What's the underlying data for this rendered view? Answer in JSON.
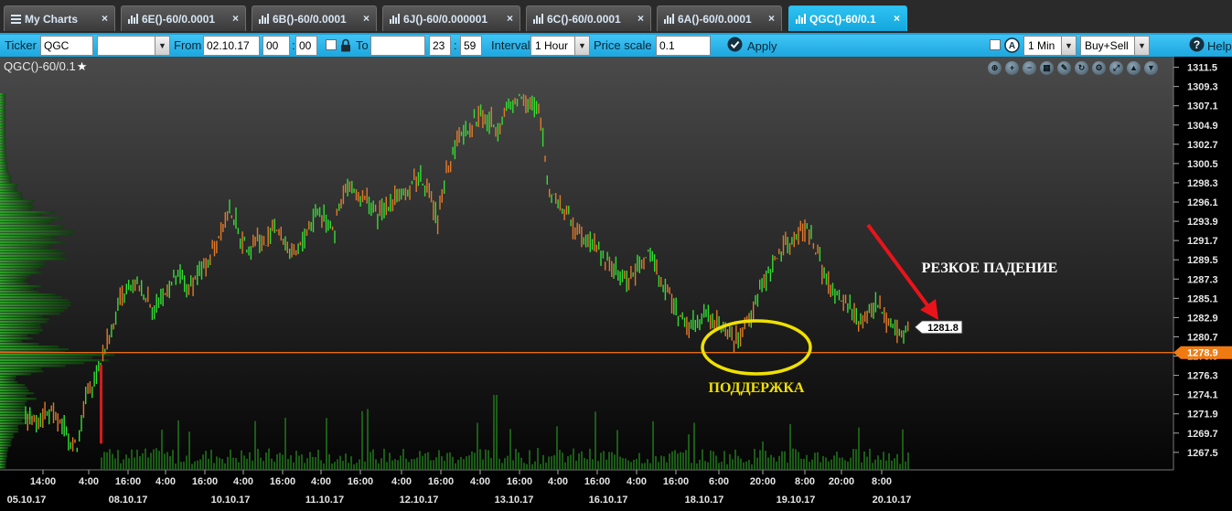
{
  "tabs": [
    {
      "label": "My Charts",
      "x": 4,
      "w": 122,
      "icon": "list-icon",
      "active": false
    },
    {
      "label": "6E()-60/0.0001",
      "x": 132,
      "w": 137,
      "icon": "bar-chart-icon",
      "active": false
    },
    {
      "label": "6B()-60/0.0001",
      "x": 275,
      "w": 137,
      "icon": "bar-chart-icon",
      "active": false
    },
    {
      "label": "6J()-60/0.000001",
      "x": 418,
      "w": 151,
      "icon": "bar-chart-icon",
      "active": false
    },
    {
      "label": "6C()-60/0.0001",
      "x": 575,
      "w": 137,
      "icon": "bar-chart-icon",
      "active": false
    },
    {
      "label": "6A()-60/0.0001",
      "x": 718,
      "w": 137,
      "icon": "bar-chart-icon",
      "active": false
    },
    {
      "label": "QGC()-60/0.1",
      "x": 862,
      "w": 130,
      "icon": "bar-chart-icon",
      "active": true
    }
  ],
  "toolbar": {
    "ticker_label": "Ticker",
    "ticker_value": "QGC",
    "ticker_select_value": "",
    "from_label": "From",
    "from_date": "02.10.17",
    "from_hour": "00",
    "from_min": "00",
    "to_label": "To",
    "to_date": "",
    "to_hour": "23",
    "to_min": "59",
    "interval_label": "Interval",
    "interval_value": "1 Hour",
    "price_scale_label": "Price scale",
    "price_scale_value": "0.1",
    "apply_label": "Apply",
    "timeframe_value": "1 Min",
    "side_value": "Buy+Sell",
    "help_label": "Help"
  },
  "chart": {
    "title": "QGC()-60/0.1",
    "current_price_label": "1281.8",
    "support_level_label": "1278.9",
    "annotation_support": "ПОДДЕРЖКА",
    "annotation_drop": "РЕЗКОЕ ПАДЕНИЕ",
    "colors": {
      "up_bar": "#33dd33",
      "down_bar": "#e07a2a",
      "support_line": "#e86a10",
      "circle": "#f0e000",
      "arrow": "#e8141a",
      "profile": "#2fae2a"
    }
  },
  "chart_data": {
    "type": "line",
    "title": "QGC()-60/0.1",
    "xlabel": "",
    "ylabel": "",
    "y_ticks": [
      "1311.5",
      "1309.3",
      "1307.1",
      "1304.9",
      "1302.7",
      "1300.5",
      "1298.3",
      "1296.1",
      "1293.9",
      "1291.7",
      "1289.5",
      "1287.3",
      "1285.1",
      "1282.9",
      "1280.7",
      "1278.5",
      "1276.3",
      "1274.1",
      "1271.9",
      "1269.7",
      "1267.5"
    ],
    "ylim": [
      1265.5,
      1312.5
    ],
    "x_time_labels": [
      "14:00",
      "4:00",
      "16:00",
      "4:00",
      "16:00",
      "4:00",
      "16:00",
      "4:00",
      "16:00",
      "4:00",
      "16:00",
      "4:00",
      "16:00",
      "4:00",
      "16:00",
      "4:00",
      "16:00",
      "6:00",
      "20:00",
      "8:00",
      "20:00",
      "8:00"
    ],
    "x_date_labels": [
      "05.10.17",
      "08.10.17",
      "10.10.17",
      "11.10.17",
      "12.10.17",
      "13.10.17",
      "16.10.17",
      "18.10.17",
      "19.10.17",
      "20.10.17"
    ],
    "series": [
      {
        "values": [
          1271.5,
          1271.0,
          1272.0,
          1271.8,
          1270.5,
          1269.6,
          1268.0,
          1273.5,
          1276.0,
          1278.5,
          1281.5,
          1284.5,
          1286.0,
          1286.5,
          1285.4,
          1284.0,
          1285.2,
          1286.8,
          1287.3,
          1286.1,
          1287.8,
          1289.2,
          1291.1,
          1293.6,
          1294.9,
          1292.2,
          1290.8,
          1292.0,
          1291.2,
          1293.5,
          1291.8,
          1289.7,
          1291.0,
          1293.1,
          1295.2,
          1294.1,
          1293.0,
          1297.0,
          1297.7,
          1296.5,
          1295.9,
          1294.3,
          1295.6,
          1296.9,
          1296.4,
          1298.3,
          1299.1,
          1297.0,
          1293.8,
          1299.4,
          1302.5,
          1304.4,
          1305.1,
          1306.0,
          1305.3,
          1304.6,
          1306.7,
          1307.6,
          1308.4,
          1307.0,
          1305.5,
          1297.4,
          1296.2,
          1294.7,
          1293.0,
          1292.5,
          1291.3,
          1290.2,
          1288.9,
          1287.8,
          1287.1,
          1288.0,
          1289.6,
          1290.1,
          1287.5,
          1285.3,
          1283.3,
          1281.8,
          1282.7,
          1283.4,
          1282.5,
          1282.2,
          1281.1,
          1280.2,
          1282.4,
          1284.5,
          1287.3,
          1289.0,
          1290.2,
          1291.4,
          1292.3,
          1293.1,
          1290.6,
          1287.8,
          1285.6,
          1284.6,
          1284.2,
          1282.7,
          1283.0,
          1284.5,
          1283.3,
          1282.0,
          1281.3,
          1281.8
        ],
        "color": "#33dd33"
      }
    ],
    "support_level": 1278.9,
    "last_price": 1281.8,
    "grid": false,
    "legend": "none"
  }
}
